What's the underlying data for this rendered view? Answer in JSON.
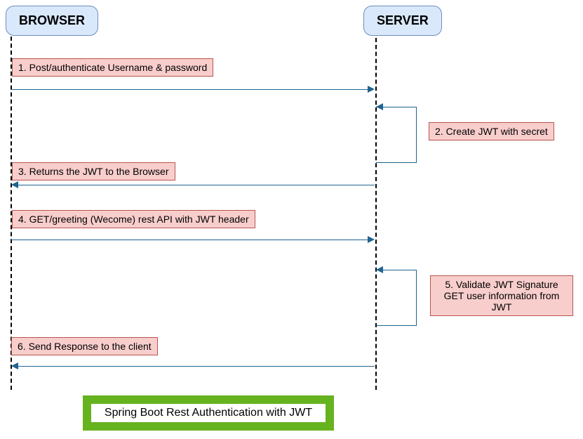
{
  "participants": {
    "browser": "BROWSER",
    "server": "SERVER"
  },
  "messages": {
    "step1": "1. Post/authenticate Username & password",
    "step2": "2. Create JWT with secret",
    "step3": "3. Returns the JWT to the Browser",
    "step4": "4. GET/greeting (Wecome) rest API with JWT header",
    "step5": "5. Validate JWT Signature GET user information from JWT",
    "step6": "6. Send Response to the client"
  },
  "title": "Spring Boot Rest Authentication with JWT"
}
